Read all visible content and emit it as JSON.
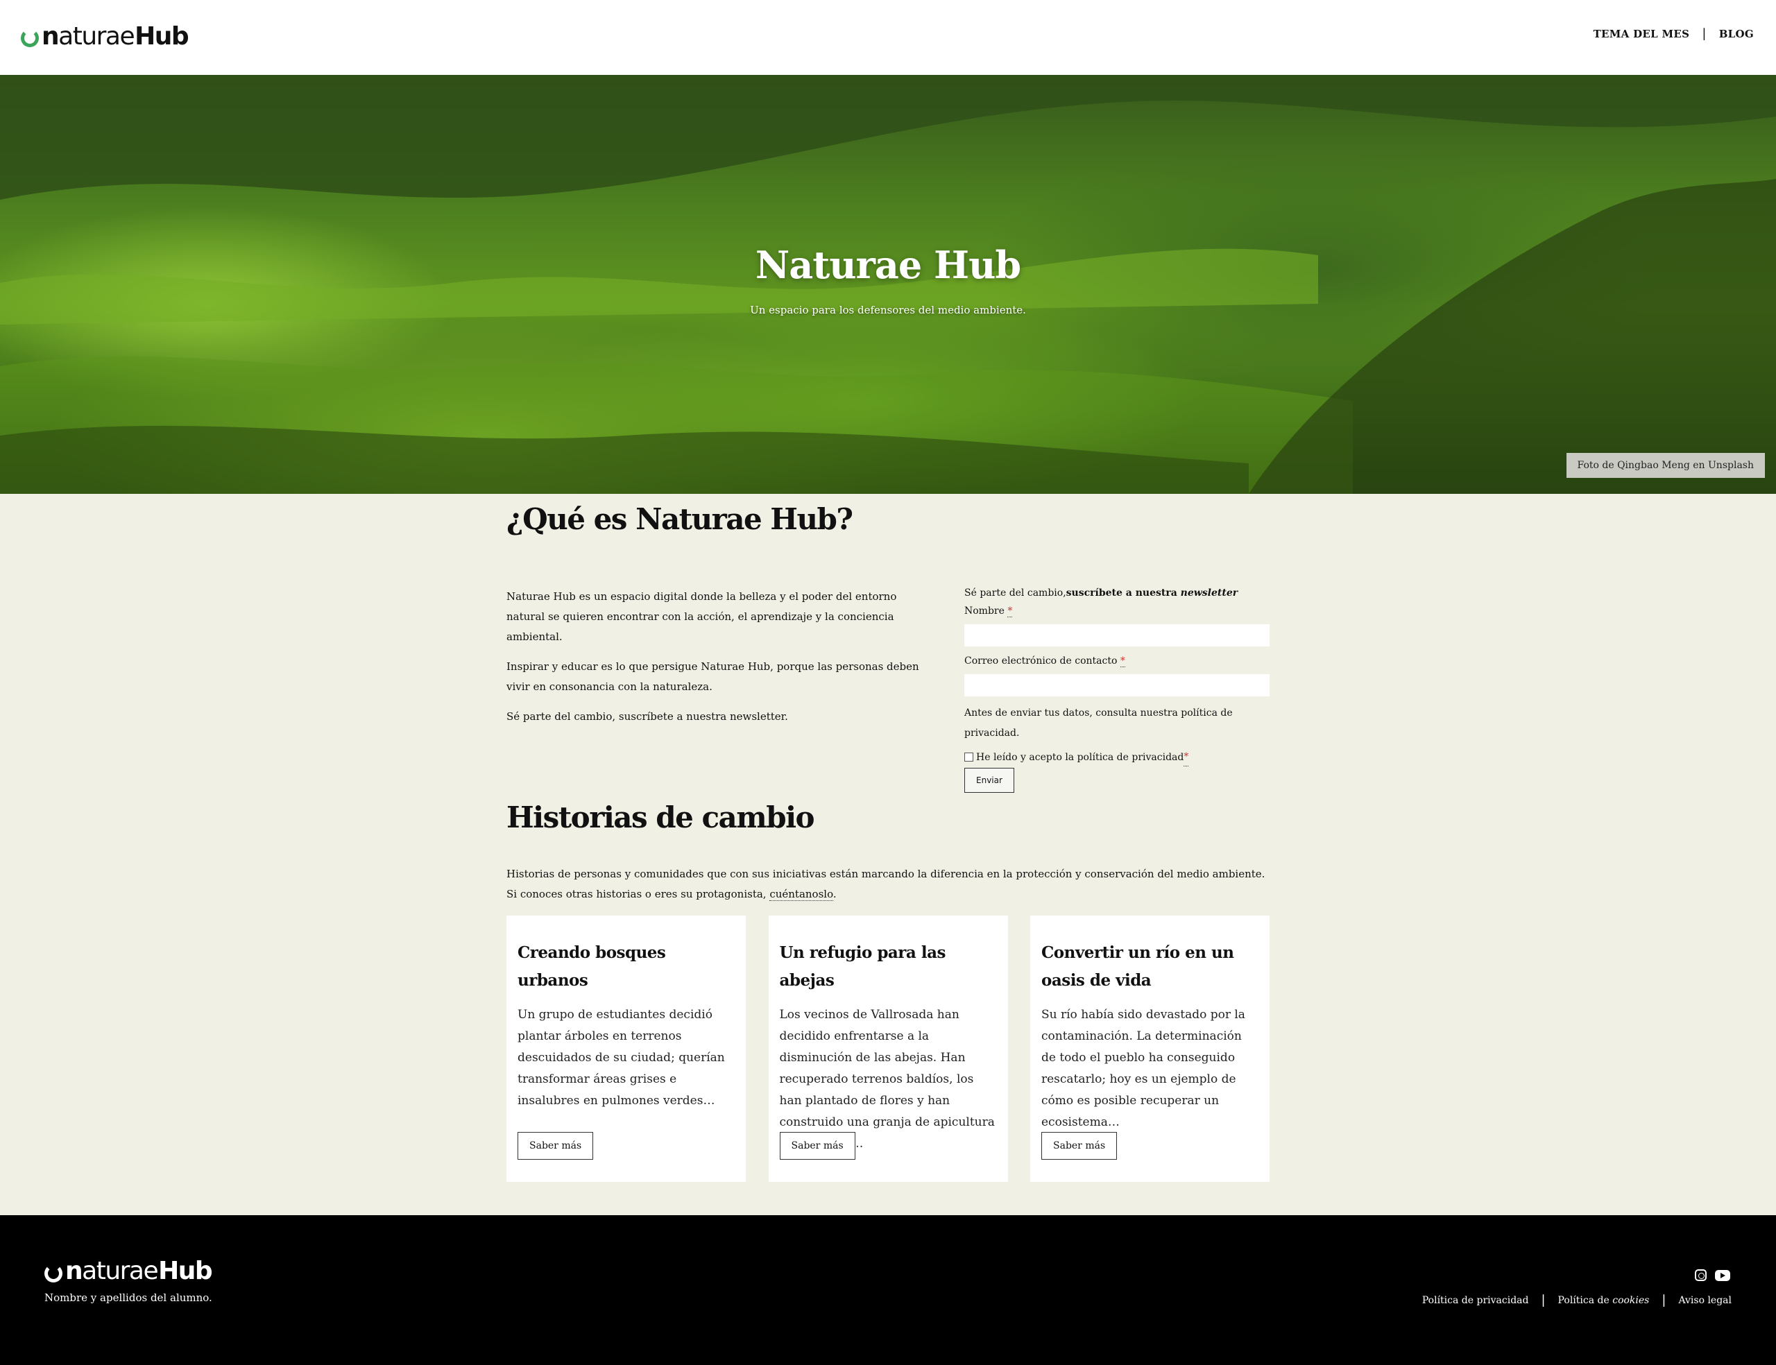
{
  "header": {
    "logo": {
      "part1": "n",
      "part2": "aturae",
      "part3": "Hub"
    },
    "nav": [
      {
        "label": "TEMA DEL MES"
      },
      {
        "label": "BLOG"
      }
    ]
  },
  "hero": {
    "title": "Naturae Hub",
    "subtitle": "Un espacio para los defensores del medio ambiente.",
    "credit": "Foto de Qingbao Meng en Unsplash"
  },
  "about": {
    "title": "¿Qué es Naturae Hub?",
    "paragraphs": [
      "Naturae Hub es un espacio digital donde la belleza y el poder del entorno natural se quieren encontrar con la acción, el aprendizaje y la conciencia ambiental.",
      "Inspirar y educar es lo que persigue Naturae Hub, porque las personas deben vivir en consonancia con la naturaleza.",
      "Sé parte del cambio, suscríbete a nuestra newsletter."
    ]
  },
  "newsletter": {
    "intro_plain": "Sé parte del cambio,",
    "intro_bold": "suscríbete a nuestra ",
    "intro_italic": "newsletter",
    "name_label": "Nombre ",
    "name_value": "",
    "email_label": "Correo electrónico de contacto ",
    "email_value": "",
    "required_mark": "*",
    "privacy_note": "Antes de enviar tus datos, consulta nuestra política de privacidad.",
    "consent_label": "He leído y acepto la política de privacidad ",
    "submit_label": "Enviar"
  },
  "stories": {
    "title": "Historias de cambio",
    "intro": "Historias de personas y comunidades que con sus iniciativas están marcando la diferencia en la protección y conservación del medio ambiente. Si conoces otras historias o eres su protagonista, ",
    "intro_link": "cuéntanoslo",
    "intro_end": ".",
    "cards": [
      {
        "title": "Creando bosques urbanos",
        "text": "Un grupo de estudiantes decidió plantar árboles en terrenos descuidados de su ciudad; querían transformar áreas grises e insalubres en pulmones verdes…",
        "button": "Saber más"
      },
      {
        "title": "Un refugio para las abejas",
        "text": "Los vecinos de Vallrosada han decidido enfrentarse a la disminución de las abejas. Han recuperado terrenos baldíos, los han plantado de flores y han construido una granja de apicultura comunitaria…",
        "button": "Saber más"
      },
      {
        "title": "Convertir un río en un oasis de vida",
        "text": "Su río había sido devastado por la contaminación. La determinación de todo el pueblo ha conseguido rescatarlo; hoy es un ejemplo de cómo es posible recuperar un ecosistema…",
        "button": "Saber más"
      }
    ]
  },
  "footer": {
    "logo": {
      "part1": "n",
      "part2": "aturae",
      "part3": "Hub"
    },
    "student": "Nombre y apellidos del alumno.",
    "social": [
      "instagram-icon",
      "youtube-icon"
    ],
    "links": [
      {
        "label": "Política de privacidad"
      },
      {
        "label_plain": "Política de ",
        "label_italic": "cookies"
      },
      {
        "label": "Aviso legal"
      }
    ]
  },
  "colors": {
    "background": "#f1f0e4",
    "accent_green": "#3aa55a",
    "footer_bg": "#000000",
    "card_bg": "#ffffff"
  }
}
